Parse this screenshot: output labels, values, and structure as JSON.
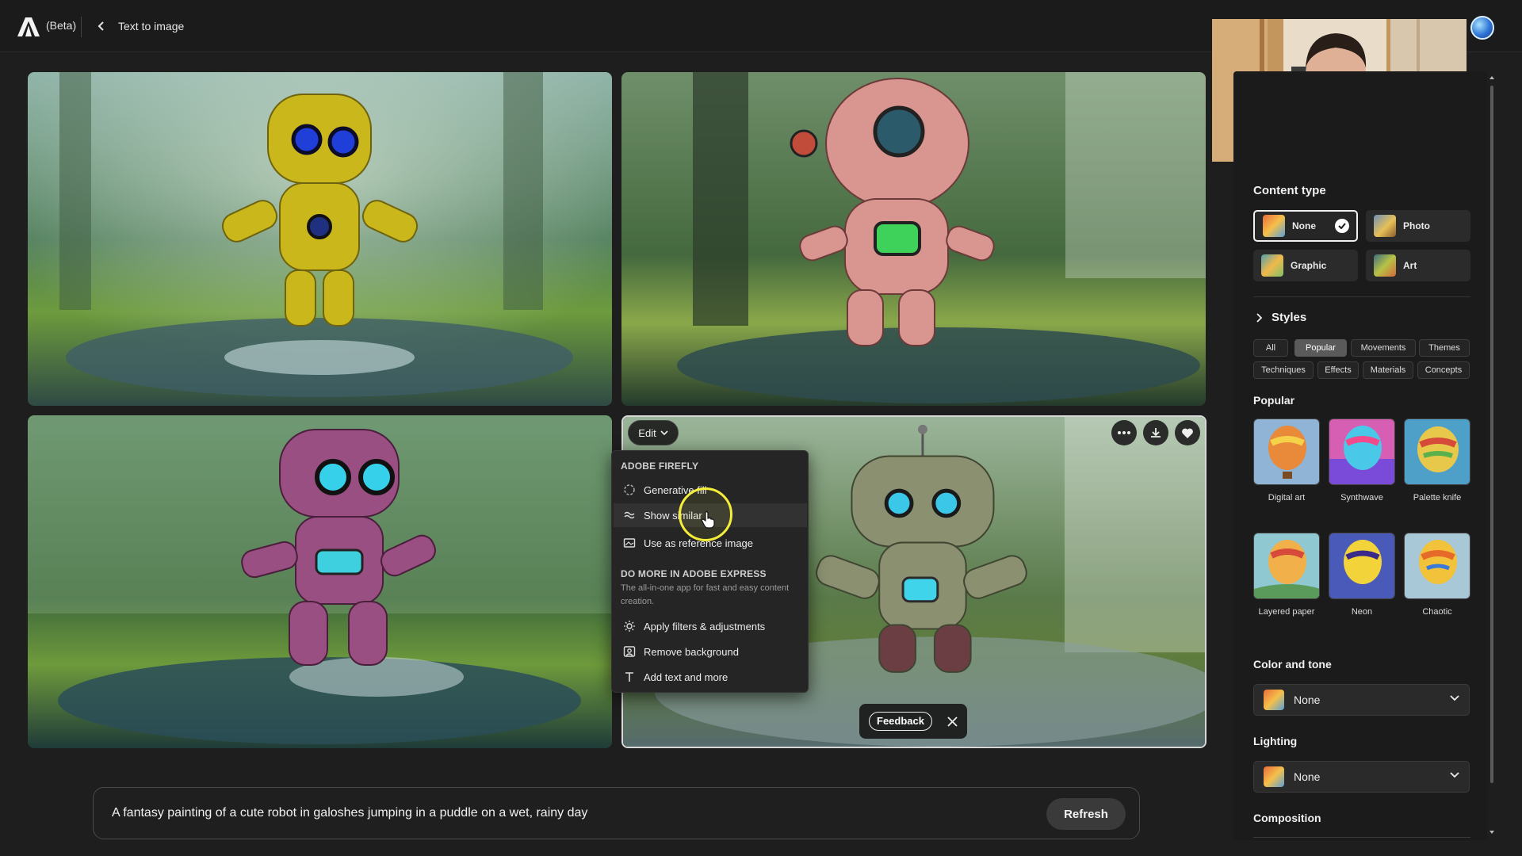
{
  "app": {
    "badge": "(Beta)",
    "breadcrumb": "Text to image"
  },
  "edit_menu": {
    "edit_label": "Edit",
    "firefly_heading": "ADOBE FIREFLY",
    "firefly_items": [
      "Generative fill",
      "Show similar",
      "Use as reference image"
    ],
    "express_heading": "DO MORE IN ADOBE EXPRESS",
    "express_desc": "The all-in-one app for fast and easy content creation.",
    "express_items": [
      "Apply filters & adjustments",
      "Remove background",
      "Add text and more"
    ]
  },
  "feedback": {
    "label": "Feedback"
  },
  "prompt": {
    "text": "A fantasy painting of a cute robot in galoshes jumping in a puddle on a wet, rainy day",
    "refresh_label": "Refresh"
  },
  "panel": {
    "content_type": {
      "label": "Content type",
      "options": [
        "None",
        "Photo",
        "Graphic",
        "Art"
      ],
      "selected": "None"
    },
    "styles": {
      "label": "Styles",
      "tabs_row1": [
        "All",
        "Popular",
        "Movements",
        "Themes"
      ],
      "tabs_row2": [
        "Techniques",
        "Effects",
        "Materials",
        "Concepts"
      ],
      "active_tab": "Popular",
      "section_label": "Popular",
      "items": [
        "Digital art",
        "Synthwave",
        "Palette knife",
        "Layered paper",
        "Neon",
        "Chaotic"
      ]
    },
    "color_tone": {
      "label": "Color and tone",
      "value": "None"
    },
    "lighting": {
      "label": "Lighting",
      "value": "None"
    },
    "composition": {
      "label": "Composition"
    }
  },
  "colors": {
    "background": "#1e1e1e",
    "panel": "#1b1b1b",
    "accent_ring": "#f4ee3a",
    "robot_yellow": "#c9b71c",
    "robot_pink": "#d9958f",
    "robot_purple": "#9a4f82",
    "robot_green": "#8a9070"
  }
}
